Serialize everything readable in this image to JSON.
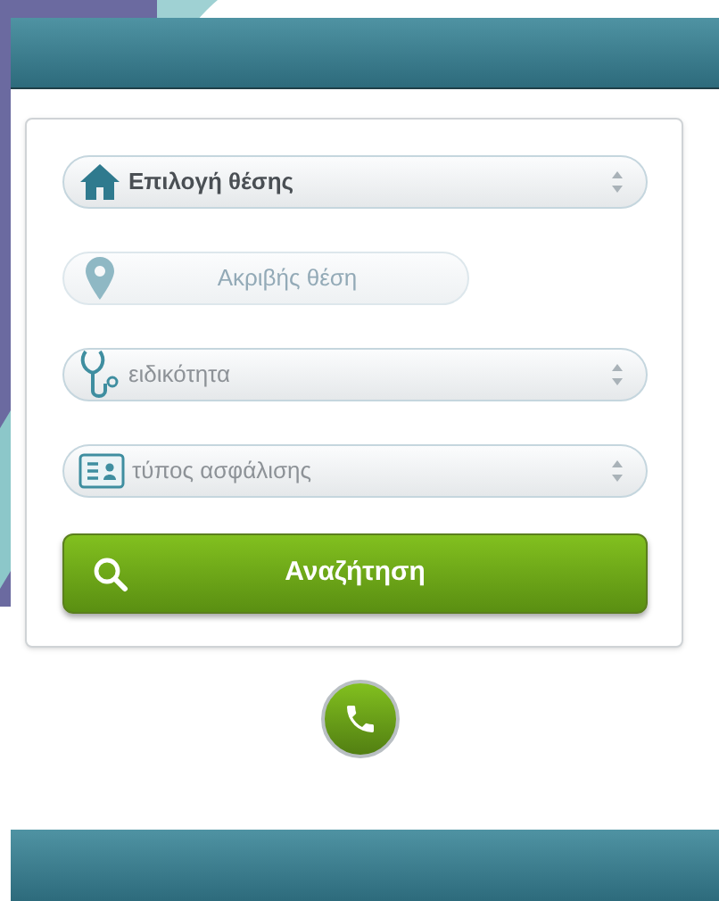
{
  "fields": [
    {
      "kind": "select",
      "value": "Επιλογή θέσης"
    },
    {
      "kind": "input",
      "placeholder": "Ακριβής θέση",
      "disabled": true
    },
    {
      "kind": "select",
      "placeholder": "ειδικότητα"
    },
    {
      "kind": "select",
      "placeholder": "τύπος ασφάλισης"
    }
  ],
  "search_button": {
    "label": "Αναζήτηση"
  }
}
